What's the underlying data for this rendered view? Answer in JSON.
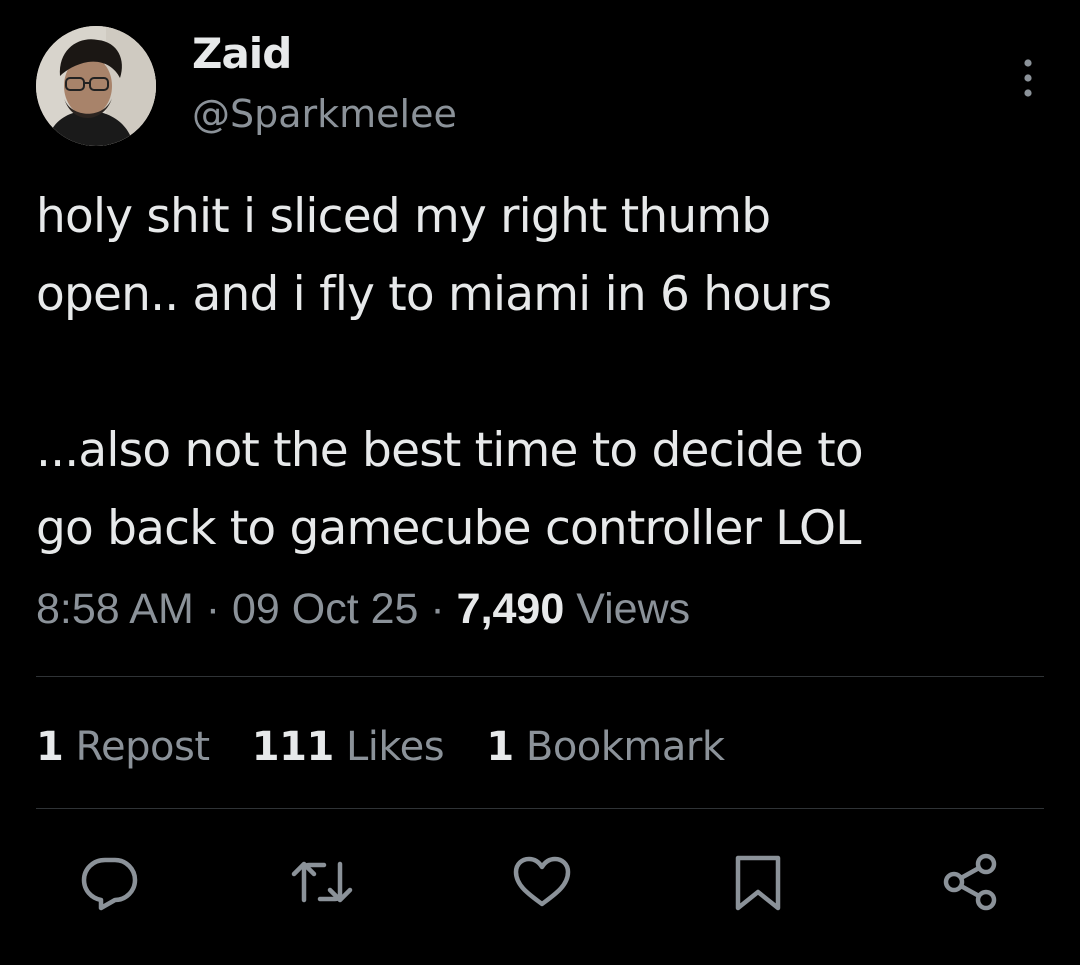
{
  "author": {
    "name": "Zaid",
    "handle": "@Sparkmelee",
    "avatar_icon": "user-avatar-photo"
  },
  "tweet": {
    "text": "holy shit i sliced my right thumb\nopen.. and i fly to miami in 6 hours\n\n...also not the best time to decide to\ngo back to gamecube controller LOL"
  },
  "meta": {
    "time": "8:58 AM",
    "sep1": " · ",
    "date": "09 Oct 25",
    "sep2": " · ",
    "views_count": "7,490",
    "views_label": " Views"
  },
  "stats": {
    "reposts_count": "1",
    "reposts_label": " Repost",
    "likes_count": "111",
    "likes_label": " Likes",
    "bookmarks_count": "1",
    "bookmarks_label": " Bookmark"
  },
  "actions": [
    {
      "icon": "reply-icon"
    },
    {
      "icon": "repost-icon"
    },
    {
      "icon": "like-icon"
    },
    {
      "icon": "bookmark-icon"
    },
    {
      "icon": "share-icon"
    }
  ],
  "colors": {
    "background": "#000000",
    "primary_text": "#e7e9ea",
    "secondary_text": "#8b9299",
    "divider": "#2f3336"
  }
}
